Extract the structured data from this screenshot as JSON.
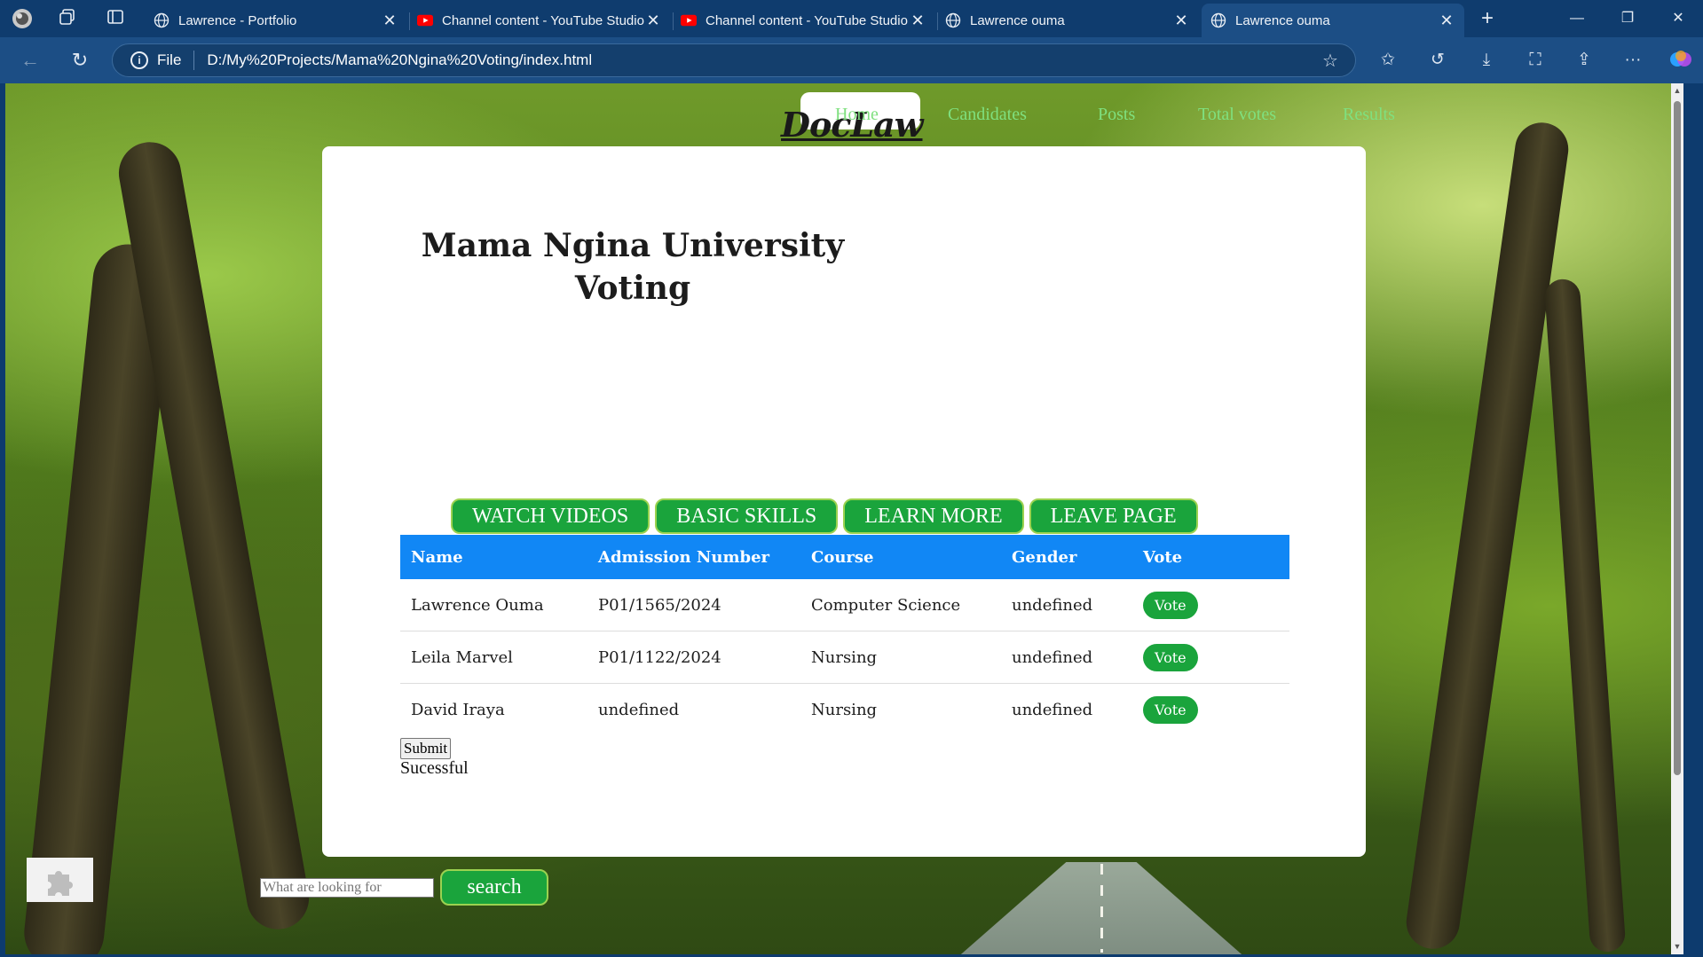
{
  "browser": {
    "tabs": [
      {
        "title": "Lawrence - Portfolio",
        "icon": "globe-icon"
      },
      {
        "title": "Channel content - YouTube Studio",
        "icon": "youtube-icon"
      },
      {
        "title": "Channel content - YouTube Studio",
        "icon": "youtube-icon"
      },
      {
        "title": "Lawrence ouma",
        "icon": "globe-icon"
      },
      {
        "title": "Lawrence ouma",
        "icon": "globe-icon",
        "active": true
      }
    ],
    "address": {
      "scheme_label": "File",
      "url": "D:/My%20Projects/Mama%20Ngina%20Voting/index.html"
    }
  },
  "site": {
    "logo": "DocLaw",
    "nav": [
      "Home",
      "Candidates",
      "Posts",
      "Total votes",
      "Results"
    ]
  },
  "card": {
    "title_line1": "Mama Ngina University",
    "title_line2": "Voting",
    "buttons": [
      "WATCH VIDEOS",
      "BASIC SKILLS",
      "LEARN MORE",
      "LEAVE PAGE"
    ],
    "table": {
      "headers": [
        "Name",
        "Admission Number",
        "Course",
        "Gender",
        "Vote"
      ],
      "rows": [
        {
          "name": "Lawrence Ouma",
          "admission": "P01/1565/2024",
          "course": "Computer Science",
          "gender": "undefined",
          "vote": "Vote"
        },
        {
          "name": "Leila Marvel",
          "admission": "P01/1122/2024",
          "course": "Nursing",
          "gender": "undefined",
          "vote": "Vote"
        },
        {
          "name": "David Iraya",
          "admission": "undefined",
          "course": "Nursing",
          "gender": "undefined",
          "vote": "Vote"
        }
      ]
    },
    "submit_label": "Submit",
    "status_text": "Sucessful"
  },
  "search": {
    "placeholder": "What are looking for",
    "button_label": "search"
  },
  "colors": {
    "accent_green": "#1aa43c",
    "table_header_blue": "#1187f5",
    "nav_link_green": "#7fe07f",
    "chrome_blue": "#1c4e85"
  }
}
